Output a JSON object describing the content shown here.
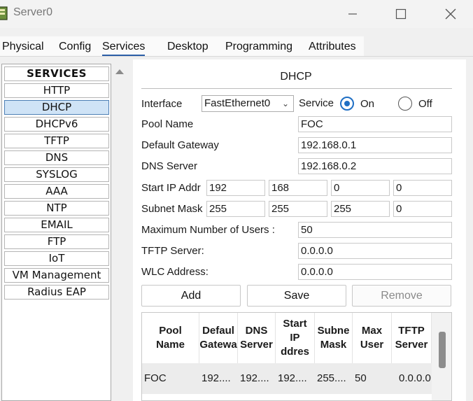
{
  "window": {
    "title": "Server0"
  },
  "tabs": [
    {
      "label": "Physical"
    },
    {
      "label": "Config"
    },
    {
      "label": "Services",
      "active": true
    },
    {
      "label": "Desktop"
    },
    {
      "label": "Programming"
    },
    {
      "label": "Attributes"
    }
  ],
  "services": {
    "header": "SERVICES",
    "items": [
      "HTTP",
      "DHCP",
      "DHCPv6",
      "TFTP",
      "DNS",
      "SYSLOG",
      "AAA",
      "NTP",
      "EMAIL",
      "FTP",
      "IoT",
      "VM Management",
      "Radius EAP"
    ],
    "selected": "DHCP"
  },
  "dhcp": {
    "title": "DHCP",
    "interface_label": "Interface",
    "interface_value": "FastEthernet0",
    "service_label": "Service",
    "on_label": "On",
    "off_label": "Off",
    "service_state": "On",
    "pool_name_label": "Pool Name",
    "pool_name": "FOC",
    "gateway_label": "Default Gateway",
    "gateway": "192.168.0.1",
    "dns_label": "DNS Server",
    "dns": "192.168.0.2",
    "start_ip_label": "Start IP Addr",
    "start_ip": [
      "192",
      "168",
      "0",
      "0"
    ],
    "subnet_label": "Subnet Mask",
    "subnet": [
      "255",
      "255",
      "255",
      "0"
    ],
    "max_users_label": "Maximum Number of Users :",
    "max_users": "50",
    "tftp_label": "TFTP Server:",
    "tftp": "0.0.0.0",
    "wlc_label": "WLC Address:",
    "wlc": "0.0.0.0",
    "add_label": "Add",
    "save_label": "Save",
    "remove_label": "Remove"
  },
  "pool_table": {
    "columns": [
      "Pool\nName",
      "Defaul\nGatewa",
      "DNS\nServer",
      "Start\nIP\nddres",
      "Subne\nMask",
      "Max\nUser",
      "TFTP\nServer"
    ],
    "row": [
      "FOC",
      "192....",
      "192....",
      "192....",
      "255....",
      "50",
      "0.0.0.0"
    ]
  },
  "colors": {
    "accent": "#1f6fc4",
    "selected_bg": "#cfe3f6"
  }
}
